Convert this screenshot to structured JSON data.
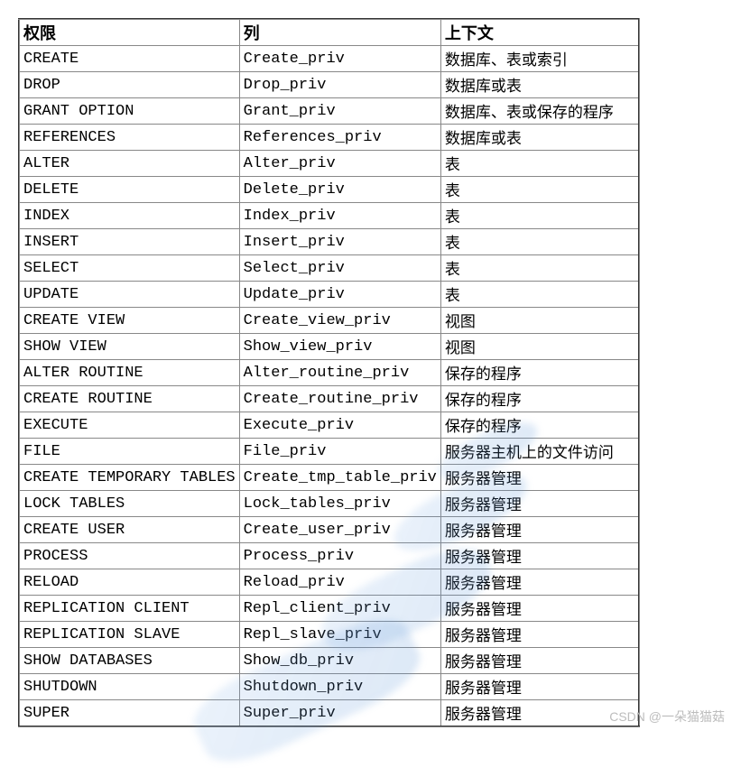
{
  "chart_data": {
    "type": "table",
    "headers": [
      "权限",
      "列",
      "上下文"
    ],
    "rows": [
      [
        "CREATE",
        "Create_priv",
        "数据库、表或索引"
      ],
      [
        "DROP",
        "Drop_priv",
        "数据库或表"
      ],
      [
        "GRANT OPTION",
        "Grant_priv",
        "数据库、表或保存的程序"
      ],
      [
        "REFERENCES",
        "References_priv",
        "数据库或表"
      ],
      [
        "ALTER",
        "Alter_priv",
        "表"
      ],
      [
        "DELETE",
        "Delete_priv",
        "表"
      ],
      [
        "INDEX",
        "Index_priv",
        "表"
      ],
      [
        "INSERT",
        "Insert_priv",
        "表"
      ],
      [
        "SELECT",
        "Select_priv",
        "表"
      ],
      [
        "UPDATE",
        "Update_priv",
        "表"
      ],
      [
        "CREATE VIEW",
        "Create_view_priv",
        "视图"
      ],
      [
        "SHOW VIEW",
        "Show_view_priv",
        "视图"
      ],
      [
        "ALTER ROUTINE",
        "Alter_routine_priv",
        "保存的程序"
      ],
      [
        "CREATE ROUTINE",
        "Create_routine_priv",
        "保存的程序"
      ],
      [
        "EXECUTE",
        "Execute_priv",
        "保存的程序"
      ],
      [
        "FILE",
        "File_priv",
        "服务器主机上的文件访问"
      ],
      [
        "CREATE TEMPORARY TABLES",
        "Create_tmp_table_priv",
        "服务器管理"
      ],
      [
        "LOCK TABLES",
        "Lock_tables_priv",
        "服务器管理"
      ],
      [
        "CREATE USER",
        "Create_user_priv",
        "服务器管理"
      ],
      [
        "PROCESS",
        "Process_priv",
        "服务器管理"
      ],
      [
        "RELOAD",
        "Reload_priv",
        "服务器管理"
      ],
      [
        "REPLICATION CLIENT",
        "Repl_client_priv",
        "服务器管理"
      ],
      [
        "REPLICATION SLAVE",
        "Repl_slave_priv",
        "服务器管理"
      ],
      [
        "SHOW DATABASES",
        "Show_db_priv",
        "服务器管理"
      ],
      [
        "SHUTDOWN",
        "Shutdown_priv",
        "服务器管理"
      ],
      [
        "SUPER",
        "Super_priv",
        "服务器管理"
      ]
    ]
  },
  "watermark": "CSDN @一朵猫猫菇"
}
